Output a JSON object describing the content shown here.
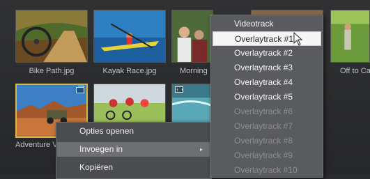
{
  "thumbnails": [
    {
      "caption": "Bike Path.jpg"
    },
    {
      "caption": "Kayak Race.jpg"
    },
    {
      "caption": "Morning"
    },
    {
      "caption": ""
    },
    {
      "caption": "Off to Ca"
    },
    {
      "caption": "Adventure V"
    }
  ],
  "context_menu": {
    "items": [
      {
        "label": "Opties openen"
      },
      {
        "label": "Invoegen in",
        "arrow": "▸"
      },
      {
        "label": "Kopiëren"
      }
    ]
  },
  "submenu": {
    "items": [
      {
        "label": "Videotrack",
        "enabled": true
      },
      {
        "label": "Overlaytrack #1",
        "enabled": true,
        "highlighted": true
      },
      {
        "label": "Overlaytrack #2",
        "enabled": true
      },
      {
        "label": "Overlaytrack #3",
        "enabled": true
      },
      {
        "label": "Overlaytrack #4",
        "enabled": true
      },
      {
        "label": "Overlaytrack #5",
        "enabled": true
      },
      {
        "label": "Overlaytrack #6",
        "enabled": false
      },
      {
        "label": "Overlaytrack #7",
        "enabled": false
      },
      {
        "label": "Overlaytrack #8",
        "enabled": false
      },
      {
        "label": "Overlaytrack #9",
        "enabled": false
      },
      {
        "label": "Overlaytrack #10",
        "enabled": false
      }
    ]
  },
  "icons": {
    "badge_stack": "overlay-stack-icon",
    "badge_film": "film-icon",
    "cursor": "mouse-pointer-icon"
  },
  "colors": {
    "selection_border": "#d9b64a",
    "menu_highlight": "#f5f5f5",
    "disabled_text": "#8d8e91"
  }
}
